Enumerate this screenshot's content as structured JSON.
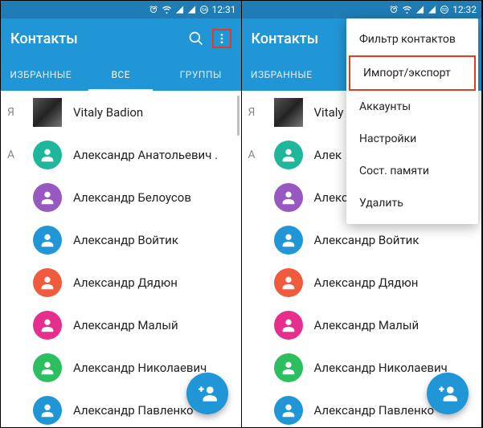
{
  "status": {
    "time_left": "12:31",
    "time_right": "12:32"
  },
  "app": {
    "title": "Контакты"
  },
  "tabs": {
    "fav": "ИЗБРАННЫЕ",
    "all": "ВСЕ",
    "groups": "ГРУППЫ"
  },
  "sections": {
    "ya": "Я",
    "a": "А"
  },
  "contacts": [
    {
      "name": "Vitaly Badion",
      "color": "photo",
      "section": "Я"
    },
    {
      "name": "Александр Анатольевич .",
      "color": "#1eb79b",
      "section": "А"
    },
    {
      "name": "Александр Белоусов",
      "color": "#9858c1"
    },
    {
      "name": "Александр Войтик",
      "color": "#2196d6"
    },
    {
      "name": "Александр Дядюн",
      "color": "#ef5b3c"
    },
    {
      "name": "Александр Малый",
      "color": "#e62e8d"
    },
    {
      "name": "Александр Николаевич",
      "color": "#2cbf5f"
    },
    {
      "name": "Александр Павленко",
      "color": "#2196d6"
    }
  ],
  "menu": {
    "filter": "Фильтр контактов",
    "import_export": "Импорт/экспорт",
    "accounts": "Аккаунты",
    "settings": "Настройки",
    "memory": "Сост. памяти",
    "delete": "Удалить"
  }
}
